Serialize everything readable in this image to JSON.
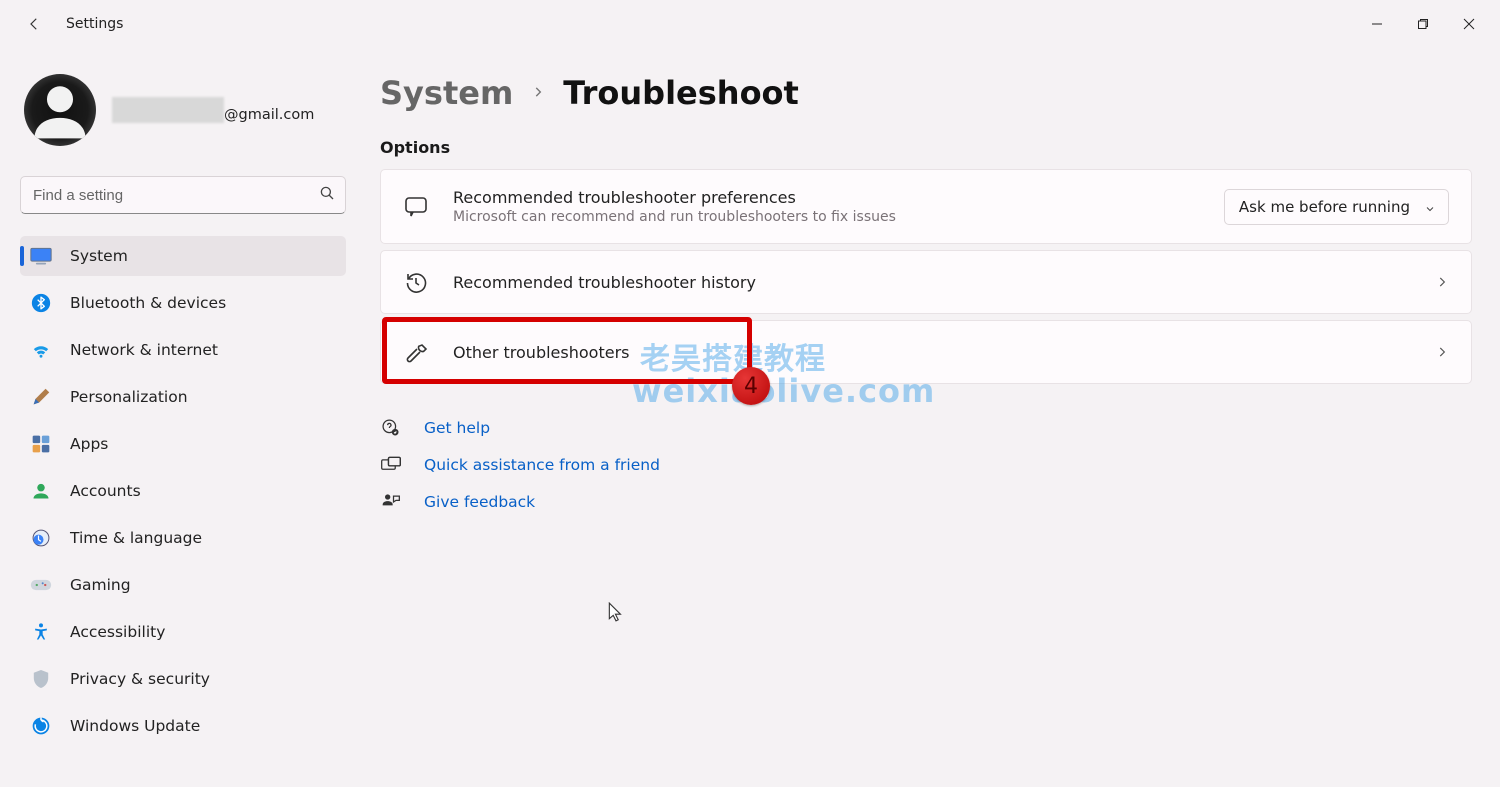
{
  "app_title": "Settings",
  "profile": {
    "email_suffix": "@gmail.com"
  },
  "search": {
    "placeholder": "Find a setting"
  },
  "sidebar": {
    "items": [
      {
        "label": "System",
        "active": true
      },
      {
        "label": "Bluetooth & devices"
      },
      {
        "label": "Network & internet"
      },
      {
        "label": "Personalization"
      },
      {
        "label": "Apps"
      },
      {
        "label": "Accounts"
      },
      {
        "label": "Time & language"
      },
      {
        "label": "Gaming"
      },
      {
        "label": "Accessibility"
      },
      {
        "label": "Privacy & security"
      },
      {
        "label": "Windows Update"
      }
    ]
  },
  "breadcrumb": {
    "parent": "System",
    "current": "Troubleshoot"
  },
  "section_label": "Options",
  "cards": {
    "rec_pref": {
      "title": "Recommended troubleshooter preferences",
      "sub": "Microsoft can recommend and run troubleshooters to fix issues",
      "dropdown_value": "Ask me before running"
    },
    "history": {
      "title": "Recommended troubleshooter history"
    },
    "other": {
      "title": "Other troubleshooters"
    }
  },
  "highlight_badge": "4",
  "links": {
    "get_help": "Get help",
    "quick_assist": "Quick assistance from a friend",
    "feedback": "Give feedback"
  },
  "watermarks": {
    "line1": "老吴搭建教程",
    "line2": "weixiaolive.com"
  }
}
